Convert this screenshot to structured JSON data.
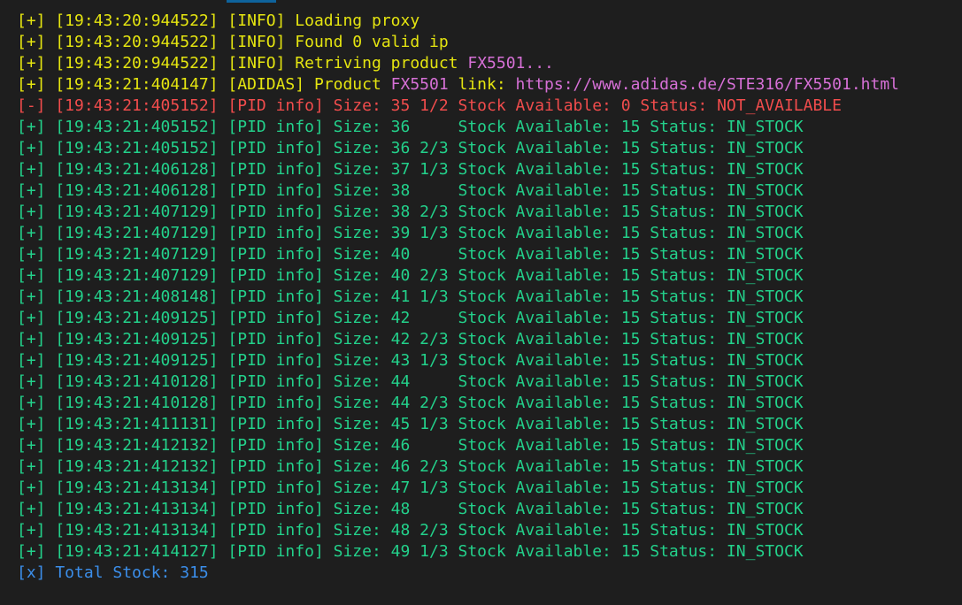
{
  "terminal": {
    "info_lines": [
      {
        "prefix": "[+] [19:43:20:944522] [INFO] ",
        "text": "Loading proxy"
      },
      {
        "prefix": "[+] [19:43:20:944522] [INFO] ",
        "text": "Found 0 valid ip"
      },
      {
        "prefix": "[+] [19:43:20:944522] [INFO] ",
        "text": "Retriving product ",
        "highlight": "FX5501..."
      }
    ],
    "product_line": {
      "prefix": "[+] [19:43:21:404147] [ADIDAS] Product ",
      "sku": "FX5501",
      "middle": " link: ",
      "url": "https://www.adidas.de/STE316/FX5501.html"
    },
    "error_line": "[-] [19:43:21:405152] [PID info] Size: 35 1/2 Stock Available: 0 Status: NOT_AVAILABLE",
    "stock_lines": [
      "[+] [19:43:21:405152] [PID info] Size: 36     Stock Available: 15 Status: IN_STOCK",
      "[+] [19:43:21:405152] [PID info] Size: 36 2/3 Stock Available: 15 Status: IN_STOCK",
      "[+] [19:43:21:406128] [PID info] Size: 37 1/3 Stock Available: 15 Status: IN_STOCK",
      "[+] [19:43:21:406128] [PID info] Size: 38     Stock Available: 15 Status: IN_STOCK",
      "[+] [19:43:21:407129] [PID info] Size: 38 2/3 Stock Available: 15 Status: IN_STOCK",
      "[+] [19:43:21:407129] [PID info] Size: 39 1/3 Stock Available: 15 Status: IN_STOCK",
      "[+] [19:43:21:407129] [PID info] Size: 40     Stock Available: 15 Status: IN_STOCK",
      "[+] [19:43:21:407129] [PID info] Size: 40 2/3 Stock Available: 15 Status: IN_STOCK",
      "[+] [19:43:21:408148] [PID info] Size: 41 1/3 Stock Available: 15 Status: IN_STOCK",
      "[+] [19:43:21:409125] [PID info] Size: 42     Stock Available: 15 Status: IN_STOCK",
      "[+] [19:43:21:409125] [PID info] Size: 42 2/3 Stock Available: 15 Status: IN_STOCK",
      "[+] [19:43:21:409125] [PID info] Size: 43 1/3 Stock Available: 15 Status: IN_STOCK",
      "[+] [19:43:21:410128] [PID info] Size: 44     Stock Available: 15 Status: IN_STOCK",
      "[+] [19:43:21:410128] [PID info] Size: 44 2/3 Stock Available: 15 Status: IN_STOCK",
      "[+] [19:43:21:411131] [PID info] Size: 45 1/3 Stock Available: 15 Status: IN_STOCK",
      "[+] [19:43:21:412132] [PID info] Size: 46     Stock Available: 15 Status: IN_STOCK",
      "[+] [19:43:21:412132] [PID info] Size: 46 2/3 Stock Available: 15 Status: IN_STOCK",
      "[+] [19:43:21:413134] [PID info] Size: 47 1/3 Stock Available: 15 Status: IN_STOCK",
      "[+] [19:43:21:413134] [PID info] Size: 48     Stock Available: 15 Status: IN_STOCK",
      "[+] [19:43:21:413134] [PID info] Size: 48 2/3 Stock Available: 15 Status: IN_STOCK",
      "[+] [19:43:21:414127] [PID info] Size: 49 1/3 Stock Available: 15 Status: IN_STOCK"
    ],
    "total_line": "[x] Total Stock: 315"
  },
  "colors": {
    "background": "#1e1e1e",
    "info": "#e5e510",
    "highlight": "#d670d6",
    "error": "#f14c4c",
    "success": "#23d18b",
    "total": "#3b8eea",
    "tab_indicator": "#0e639c"
  }
}
